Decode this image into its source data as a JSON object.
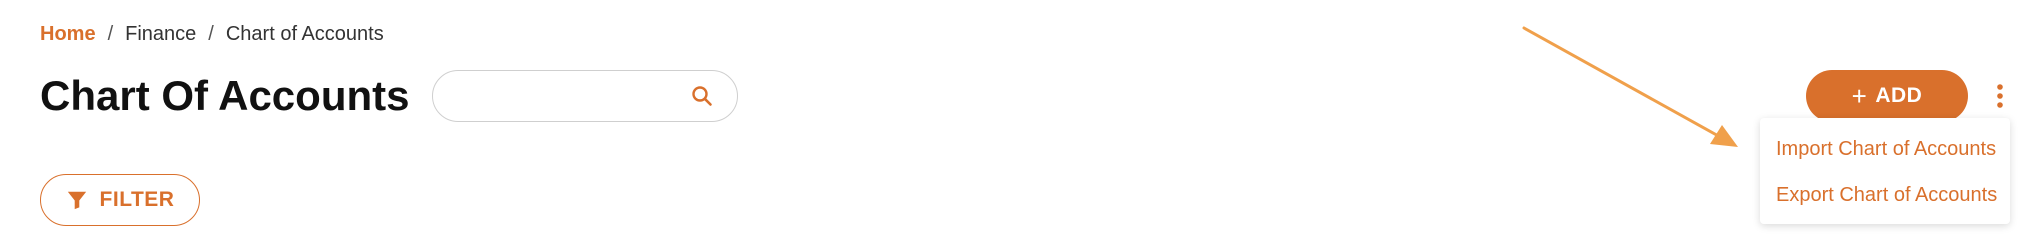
{
  "breadcrumb": {
    "home": "Home",
    "separator": "/",
    "finance": "Finance",
    "current": "Chart of Accounts"
  },
  "page": {
    "title": "Chart Of Accounts"
  },
  "search": {
    "value": "",
    "placeholder": "",
    "icon": "search-icon"
  },
  "toolbar": {
    "filter_label": "FILTER",
    "filter_icon": "funnel-icon",
    "add_plus": "+",
    "add_label": "ADD",
    "more_icon": "kebab-menu-icon"
  },
  "more_menu": {
    "items": [
      {
        "label": "Import Chart of Accounts"
      },
      {
        "label": "Export Chart of Accounts"
      }
    ]
  },
  "colors": {
    "accent": "#D9702C",
    "annotation_arrow": "#F0A04B",
    "text": "#111111",
    "border": "#cfcfcf"
  }
}
